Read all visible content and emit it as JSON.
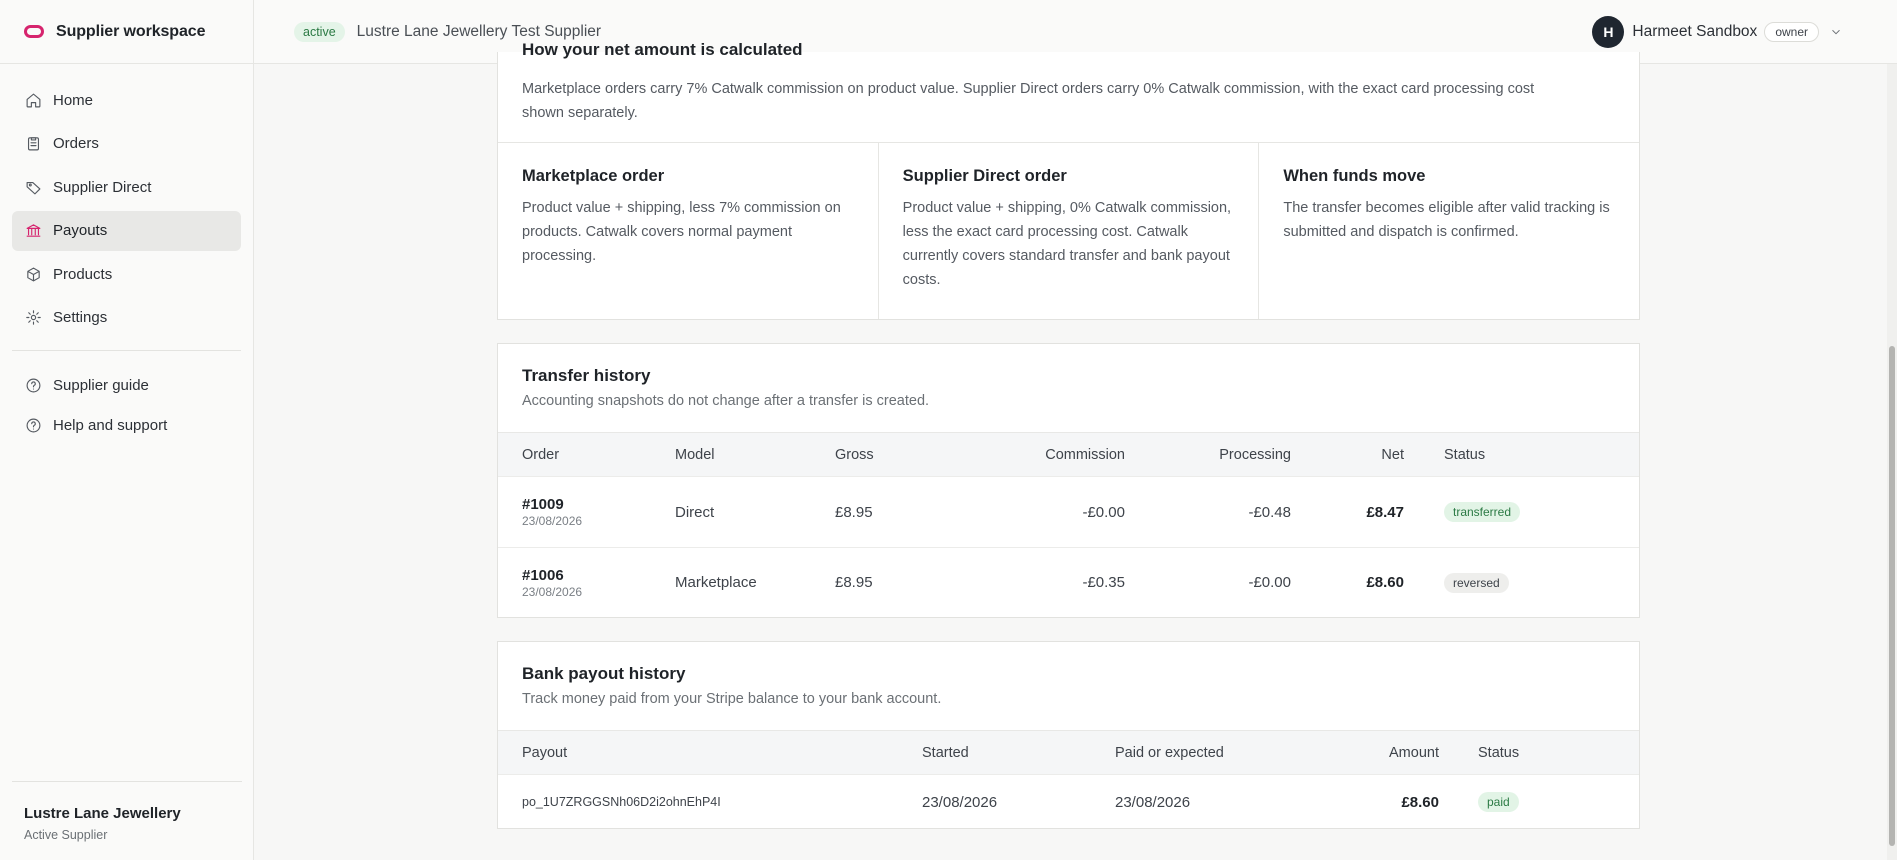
{
  "app": {
    "name": "Supplier workspace",
    "logo_icon": "catwalk-logo-icon",
    "accent": "#d6246e"
  },
  "sidebar": {
    "items": [
      {
        "label": "Home",
        "icon": "home-icon"
      },
      {
        "label": "Orders",
        "icon": "clipboard-icon"
      },
      {
        "label": "Supplier Direct",
        "icon": "tag-icon"
      },
      {
        "label": "Payouts",
        "icon": "bank-icon",
        "active": true
      },
      {
        "label": "Products",
        "icon": "box-icon"
      },
      {
        "label": "Settings",
        "icon": "gear-icon"
      }
    ],
    "secondary": [
      {
        "label": "Supplier guide",
        "icon": "help-circle-icon"
      },
      {
        "label": "Help and support",
        "icon": "help-circle-icon"
      }
    ],
    "footer": {
      "company": "Lustre Lane Jewellery",
      "role": "Active Supplier"
    }
  },
  "topbar": {
    "status": "active",
    "supplier": "Lustre Lane Jewellery Test Supplier",
    "user": {
      "initial": "H",
      "name": "Harmeet Sandbox",
      "role": "owner"
    }
  },
  "fees": {
    "heading": "How your net amount is calculated",
    "intro": "Marketplace orders carry 7% Catwalk commission on product value. Supplier Direct orders carry 0% Catwalk commission, with the exact card processing cost shown separately.",
    "columns": [
      {
        "title": "Marketplace order",
        "body": "Product value + shipping, less 7% commission on products. Catwalk covers normal payment processing."
      },
      {
        "title": "Supplier Direct order",
        "body": "Product value + shipping, 0% Catwalk commission, less the exact card processing cost. Catwalk currently covers standard transfer and bank payout costs."
      },
      {
        "title": "When funds move",
        "body": "The transfer becomes eligible after valid tracking is submitted and dispatch is confirmed."
      }
    ]
  },
  "transfers": {
    "title": "Transfer history",
    "subtitle": "Accounting snapshots do not change after a transfer is created.",
    "headers": {
      "order": "Order",
      "model": "Model",
      "gross": "Gross",
      "commission": "Commission",
      "processing": "Processing",
      "net": "Net",
      "status": "Status"
    },
    "rows": [
      {
        "order": "#1009",
        "date": "23/08/2026",
        "model": "Direct",
        "gross": "£8.95",
        "commission": "-£0.00",
        "processing": "-£0.48",
        "net": "£8.47",
        "status": "transferred"
      },
      {
        "order": "#1006",
        "date": "23/08/2026",
        "model": "Marketplace",
        "gross": "£8.95",
        "commission": "-£0.35",
        "processing": "-£0.00",
        "net": "£8.60",
        "status": "reversed"
      }
    ]
  },
  "bank_payouts": {
    "title": "Bank payout history",
    "subtitle": "Track money paid from your Stripe balance to your bank account.",
    "headers": {
      "payout": "Payout",
      "started": "Started",
      "paid": "Paid or expected",
      "amount": "Amount",
      "status": "Status"
    },
    "rows": [
      {
        "id": "po_1U7ZRGGSNh06D2i2ohnEhP4I",
        "started": "23/08/2026",
        "paid": "23/08/2026",
        "amount": "£8.60",
        "status": "paid"
      }
    ]
  }
}
